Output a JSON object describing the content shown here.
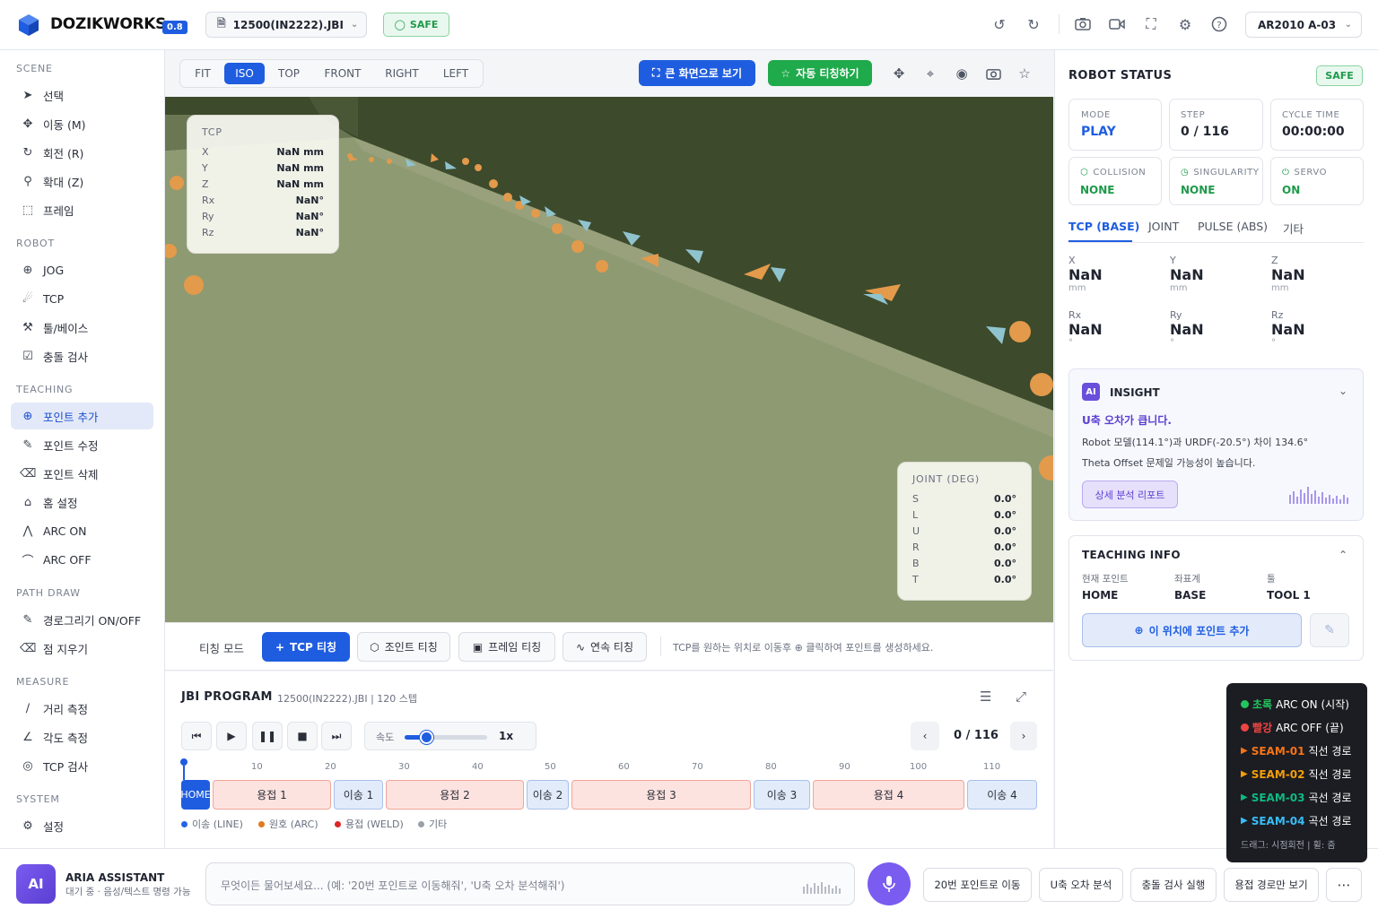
{
  "app": {
    "brand": "DOZIKWORKS",
    "version": "0.8",
    "file": "12500(IN2222).JBI",
    "safety": "SAFE",
    "robot": "AR2010 A-03"
  },
  "sidebar": {
    "sections": [
      {
        "title": "SCENE",
        "items": [
          "선택",
          "이동 (M)",
          "회전 (R)",
          "확대 (Z)",
          "프레임"
        ]
      },
      {
        "title": "ROBOT",
        "items": [
          "JOG",
          "TCP",
          "툴/베이스",
          "충돌 검사"
        ]
      },
      {
        "title": "TEACHING",
        "items": [
          "포인트 추가",
          "포인트 수정",
          "포인트 삭제",
          "홈 설정",
          "ARC ON",
          "ARC OFF"
        ]
      },
      {
        "title": "PATH DRAW",
        "items": [
          "경로그리기 ON/OFF",
          "점 지우기"
        ]
      },
      {
        "title": "MEASURE",
        "items": [
          "거리 측정",
          "각도 측정",
          "TCP 검사"
        ]
      },
      {
        "title": "SYSTEM",
        "items": [
          "설정"
        ]
      }
    ]
  },
  "view": {
    "modes": [
      "FIT",
      "ISO",
      "TOP",
      "FRONT",
      "RIGHT",
      "LEFT"
    ],
    "active_mode": "ISO",
    "fullscreen_label": "큰 화면으로 보기",
    "auto_teach_label": "자동 티칭하기"
  },
  "tcp_overlay": {
    "title": "TCP",
    "rows": [
      {
        "k": "X",
        "v": "NaN mm"
      },
      {
        "k": "Y",
        "v": "NaN mm"
      },
      {
        "k": "Z",
        "v": "NaN mm"
      },
      {
        "k": "Rx",
        "v": "NaN°"
      },
      {
        "k": "Ry",
        "v": "NaN°"
      },
      {
        "k": "Rz",
        "v": "NaN°"
      }
    ]
  },
  "joint_overlay": {
    "title": "JOINT (DEG)",
    "rows": [
      {
        "k": "S",
        "v": "0.0°"
      },
      {
        "k": "L",
        "v": "0.0°"
      },
      {
        "k": "U",
        "v": "0.0°"
      },
      {
        "k": "R",
        "v": "0.0°"
      },
      {
        "k": "B",
        "v": "0.0°"
      },
      {
        "k": "T",
        "v": "0.0°"
      }
    ]
  },
  "teach": {
    "mode_label": "티칭 모드",
    "buttons": [
      "TCP 티칭",
      "조인트 티칭",
      "프레임 티칭",
      "연속 티칭"
    ],
    "hint": "TCP를 원하는 위치로 이동후 ⊕ 클릭하여 포인트를 생성하세요."
  },
  "jbi": {
    "title": "JBI PROGRAM",
    "subtitle": "12500(IN2222).JBI | 120 스텝",
    "speed_label": "속도",
    "speed_value": "1x",
    "speed_fraction": 0.26,
    "step": "0 / 116",
    "ticks": [
      "10",
      "20",
      "30",
      "40",
      "50",
      "60",
      "70",
      "80",
      "90",
      "100",
      "110"
    ],
    "segments": [
      {
        "label": "HOME",
        "kind": "home"
      },
      {
        "label": "용접 1",
        "kind": "weld"
      },
      {
        "label": "이송 1",
        "kind": "move"
      },
      {
        "label": "용접 2",
        "kind": "weld"
      },
      {
        "label": "이송 2",
        "kind": "move"
      },
      {
        "label": "용접 3",
        "kind": "weld"
      },
      {
        "label": "이송 3",
        "kind": "move"
      },
      {
        "label": "용접 4",
        "kind": "weld"
      },
      {
        "label": "이송 4",
        "kind": "move"
      }
    ],
    "legend": [
      {
        "label": "이송 (LINE)",
        "color": "#2563eb"
      },
      {
        "label": "원호 (ARC)",
        "color": "#e07a1f"
      },
      {
        "label": "용접 (WELD)",
        "color": "#dc2626"
      },
      {
        "label": "기타",
        "color": "#9aa0ab"
      }
    ]
  },
  "status": {
    "title": "ROBOT STATUS",
    "badge": "SAFE",
    "cards": [
      {
        "label": "MODE",
        "value": "PLAY"
      },
      {
        "label": "STEP",
        "value": "0 / 116"
      },
      {
        "label": "CYCLE TIME",
        "value": "00:00:00"
      },
      {
        "label": "COLLISION",
        "value": "NONE"
      },
      {
        "label": "SINGULARITY",
        "value": "NONE"
      },
      {
        "label": "SERVO",
        "value": "ON"
      }
    ],
    "tabs": [
      "TCP (BASE)",
      "JOINT",
      "PULSE (ABS)",
      "기타"
    ],
    "coords": [
      {
        "label": "X",
        "value": "NaN",
        "unit": "mm"
      },
      {
        "label": "Y",
        "value": "NaN",
        "unit": "mm"
      },
      {
        "label": "Z",
        "value": "NaN",
        "unit": "mm"
      },
      {
        "label": "Rx",
        "value": "NaN",
        "unit": "°"
      },
      {
        "label": "Ry",
        "value": "NaN",
        "unit": "°"
      },
      {
        "label": "Rz",
        "value": "NaN",
        "unit": "°"
      }
    ]
  },
  "insight": {
    "badge": "AI",
    "title": "INSIGHT",
    "headline": "U축 오차가 큽니다.",
    "line1": "Robot 모델(114.1°)과 URDF(-20.5°) 차이 134.6°",
    "line2": "Theta Offset 문제일 가능성이 높습니다.",
    "button": "상세 분석 리포트"
  },
  "teaching_info": {
    "title": "TEACHING INFO",
    "fields": [
      {
        "label": "현재 포인트",
        "value": "HOME"
      },
      {
        "label": "좌표계",
        "value": "BASE"
      },
      {
        "label": "툴",
        "value": "TOOL 1"
      }
    ],
    "add_button": "이 위치에 포인트 추가"
  },
  "seam_legend": {
    "rows": [
      {
        "color": "#22c55e",
        "key": "초록",
        "text": "ARC ON (시작)",
        "shape": "dot"
      },
      {
        "color": "#ef4444",
        "key": "빨강",
        "text": "ARC OFF (끝)",
        "shape": "dot"
      },
      {
        "color": "#f97316",
        "key": "SEAM-01",
        "text": "직선 경로",
        "shape": "tri"
      },
      {
        "color": "#f59e0b",
        "key": "SEAM-02",
        "text": "직선 경로",
        "shape": "tri"
      },
      {
        "color": "#10b981",
        "key": "SEAM-03",
        "text": "곡선 경로",
        "shape": "tri"
      },
      {
        "color": "#38bdf8",
        "key": "SEAM-04",
        "text": "곡선 경로",
        "shape": "tri"
      }
    ],
    "footer": "드래그: 시점회전 | 휠: 줌"
  },
  "assistant": {
    "badge": "AI",
    "name": "ARIA ASSISTANT",
    "status": "대기 중 · 음성/텍스트 명령 가능",
    "placeholder": "무엇이든 물어보세요... (예: '20번 포인트로 이동해줘', 'U축 오차 분석해줘')",
    "quick": [
      "20번 포인트로 이동",
      "U축 오차 분석",
      "충돌 검사 실행",
      "용접 경로만 보기"
    ]
  },
  "colors": {
    "accent": "#1f5de0",
    "safe": "#1e9a4a",
    "weld": "#fde3df",
    "move": "#e2ebfa"
  }
}
